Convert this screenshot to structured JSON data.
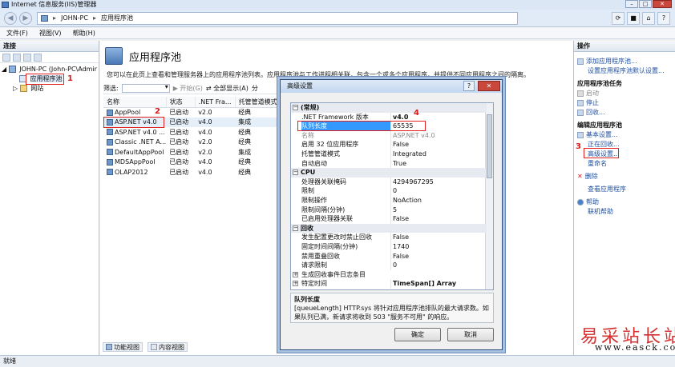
{
  "window": {
    "title": "Internet 信息服务(IIS)管理器",
    "minimize": "–",
    "maximize": "□",
    "close": "✕"
  },
  "address": {
    "back": "◀",
    "forward": "▶",
    "path": [
      "JOHN-PC",
      "应用程序池"
    ]
  },
  "menu": [
    "文件(F)",
    "视图(V)",
    "帮助(H)"
  ],
  "left": {
    "header": "连接",
    "nodes": [
      "JOHN-PC (John-PC\\Admir",
      "应用程序池",
      "网站"
    ]
  },
  "center": {
    "title": "应用程序池",
    "description": "您可以在此页上查看和管理服务器上的应用程序池列表。应用程序池与工作进程相关联，包含一个或多个应用程序，并提供不同应用程序之间的隔离。",
    "filter_label": "筛选:",
    "start": "开始(G)",
    "show_all": "全部显示(A)",
    "group_stub": "分",
    "columns": [
      "名称",
      "状态",
      ".NET Fra...",
      "托管管道模式"
    ],
    "rows": [
      [
        "AppPool",
        "已启动",
        "v2.0",
        "经典"
      ],
      [
        "ASP.NET v4.0",
        "已启动",
        "v4.0",
        "集成"
      ],
      [
        "ASP.NET v4.0 ...",
        "已启动",
        "v4.0",
        "经典"
      ],
      [
        "Classic .NET A...",
        "已启动",
        "v2.0",
        "经典"
      ],
      [
        "DefaultAppPool",
        "已启动",
        "v2.0",
        "集成"
      ],
      [
        "MDSAppPool",
        "已启动",
        "v4.0",
        "经典"
      ],
      [
        "OLAP2012",
        "已启动",
        "v4.0",
        "经典"
      ]
    ],
    "features_view": "功能视图",
    "content_view": "内容视图"
  },
  "right": {
    "header": "操作",
    "add_pool": "添加应用程序池...",
    "set_defaults": "设置应用程序池默认设置...",
    "tasks_header": "应用程序池任务",
    "start": "启动",
    "stop": "停止",
    "recycle": "回收...",
    "edit_header": "编辑应用程序池",
    "basic": "基本设置...",
    "recycling": "正在回收...",
    "advanced": "高级设置...",
    "rename": "重命名",
    "delete": "删除",
    "view_apps": "查看应用程序",
    "help": "帮助",
    "online_help": "联机帮助"
  },
  "dialog": {
    "title": "高级设置",
    "help_btn": "?",
    "close": "✕",
    "rows": [
      {
        "cat": true,
        "label": "(常规)",
        "toggle": "−"
      },
      {
        "label": ".NET Framework 版本",
        "value": "v4.0",
        "bold": true
      },
      {
        "label": "队列长度",
        "value": "65535",
        "selected": true
      },
      {
        "label": "名称",
        "value": "ASP.NET v4.0",
        "gray": true
      },
      {
        "label": "启用 32 位应用程序",
        "value": "False"
      },
      {
        "label": "托管管道模式",
        "value": "Integrated"
      },
      {
        "label": "自动启动",
        "value": "True"
      },
      {
        "cat": true,
        "label": "CPU",
        "toggle": "−"
      },
      {
        "label": "处理器关联掩码",
        "value": "4294967295"
      },
      {
        "label": "限制",
        "value": "0"
      },
      {
        "label": "限制操作",
        "value": "NoAction"
      },
      {
        "label": "限制间隔(分钟)",
        "value": "5"
      },
      {
        "label": "已启用处理器关联",
        "value": "False"
      },
      {
        "cat": true,
        "label": "回收",
        "toggle": "−"
      },
      {
        "label": "发生配置更改时禁止回收",
        "value": "False"
      },
      {
        "label": "固定时间间隔(分钟)",
        "value": "1740"
      },
      {
        "label": "禁用重叠回收",
        "value": "False"
      },
      {
        "label": "请求限制",
        "value": "0"
      },
      {
        "label": "生成回收事件日志条目",
        "value": "",
        "toggle": "+"
      },
      {
        "label": "特定时间",
        "value": "TimeSpan[] Array",
        "toggle": "+",
        "bold": true
      }
    ],
    "desc_title": "队列长度",
    "desc_text": "[queueLength] HTTP.sys 将针对应用程序池排队的最大请求数。如果队列已满，新请求将收到 503 \"服务不可用\" 的响应。",
    "ok": "确定",
    "cancel": "取消"
  },
  "annotations": [
    "1",
    "2",
    "3",
    "4"
  ],
  "status": "就绪",
  "watermark": {
    "text": "易采站长站",
    "url": "www.easck.com"
  }
}
